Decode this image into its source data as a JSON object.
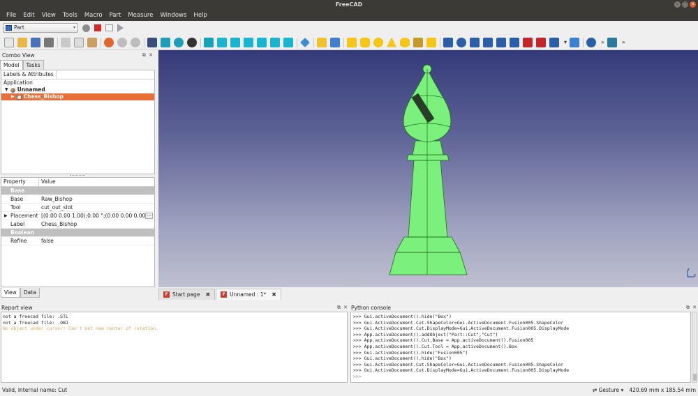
{
  "window": {
    "title": "FreeCAD"
  },
  "menu": [
    "File",
    "Edit",
    "View",
    "Tools",
    "Macro",
    "Part",
    "Measure",
    "Windows",
    "Help"
  ],
  "workbench": {
    "selected": "Part"
  },
  "combo_view": {
    "title": "Combo View",
    "tabs": [
      "Model",
      "Tasks"
    ],
    "tree_header": "Labels & Attributes",
    "tree": {
      "root": "Application",
      "document": "Unnamed",
      "selected_object": "Chess_Bishop"
    },
    "properties": {
      "header_property": "Property",
      "header_value": "Value",
      "groups": [
        {
          "name": "Base",
          "rows": [
            {
              "key": "Base",
              "value": "Raw_Bishop"
            },
            {
              "key": "Tool",
              "value": "cut_out_slot"
            },
            {
              "key": "Placement",
              "value": "[(0.00 0.00 1.00);0.00 °;(0.00 0.00 0.00)]"
            },
            {
              "key": "Label",
              "value": "Chess_Bishop"
            }
          ]
        },
        {
          "name": "Boolean",
          "rows": [
            {
              "key": "Refine",
              "value": "false"
            }
          ]
        }
      ]
    },
    "bottom_tabs": [
      "View",
      "Data"
    ]
  },
  "doc_tabs": [
    "Start page",
    "Unnamed : 1*"
  ],
  "report_view": {
    "title": "Report view",
    "lines": [
      "not a freecad file: .STL",
      "not a freecad file: .OBJ"
    ],
    "warning": "No object under cursor! Can't set new center of rotation."
  },
  "python_console": {
    "title": "Python console",
    "lines": [
      ">>> Gui.activeDocument().hide(\"Box\")",
      ">>> Gui.ActiveDocument.Cut.ShapeColor=Gui.ActiveDocument.Fusion005.ShapeColor",
      ">>> Gui.ActiveDocument.Cut.DisplayMode=Gui.ActiveDocument.Fusion005.DisplayMode",
      ">>> App.activeDocument().addObject(\"Part::Cut\",\"Cut\")",
      ">>> App.activeDocument().Cut.Base = App.activeDocument().Fusion005",
      ">>> App.activeDocument().Cut.Tool = App.activeDocument().Box",
      ">>> Gui.activeDocument().hide(\"Fusion005\")",
      ">>> Gui.activeDocument().hide(\"Box\")",
      ">>> Gui.ActiveDocument.Cut.ShapeColor=Gui.ActiveDocument.Fusion005.ShapeColor",
      ">>> Gui.ActiveDocument.Cut.DisplayMode=Gui.ActiveDocument.Fusion005.DisplayMode",
      ">>>"
    ]
  },
  "statusbar": {
    "left": "Valid, Internal name: Cut",
    "navigation": "Gesture",
    "dimensions": "420.69 mm x 185.54 mm"
  },
  "colors": {
    "selection": "#e96f39",
    "model": "#7cf07c",
    "bg_top": "#333a78",
    "bg_bottom": "#bfc0d0"
  }
}
